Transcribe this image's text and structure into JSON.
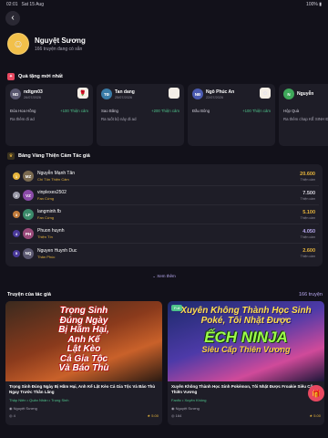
{
  "status": {
    "time": "02:01",
    "date": "Sat 15 Aug",
    "battery": "100%"
  },
  "profile": {
    "name": "Nguyệt Sương",
    "subtitle": "166 truyện đang có sẵn"
  },
  "gifts_section": {
    "title": "Quà tặng mới nhất"
  },
  "gifts": [
    {
      "initials": "ND",
      "name": "ndtgm03",
      "date": "26/07/2026",
      "item": "Đóa Hoa Hồng",
      "points": "+100 Thiện cảm",
      "message": "Ra thêm đi ad",
      "avatar_color": "#5a5870"
    },
    {
      "initials": "TĐ",
      "name": "Tan dang",
      "date": "25/07/2026",
      "item": "Sao Băng",
      "points": "+200 Thiện cảm",
      "message": "Ra tuốt bộ này đi ad",
      "avatar_color": "#3a7ca8"
    },
    {
      "initials": "NĐ",
      "name": "Ngô Phúc An",
      "date": "22/07/2026",
      "item": "Đầu Bông",
      "points": "+100 Thiện cảm",
      "message": "",
      "avatar_color": "#4a5ab0"
    },
    {
      "initials": "N",
      "name": "Nguyễn",
      "date": "",
      "item": "Hộp Quà",
      "points": "",
      "message": "Ra thêm chap KỂ SINH ĐÚNG GIAN",
      "avatar_color": "#3ea85a"
    }
  ],
  "leaderboard_section": {
    "title": "Bảng Vàng Thiện Cảm Tác giả"
  },
  "leaderboard": [
    {
      "rank": "1",
      "initials": "MZ",
      "name": "Nguyễn Mạnh Tân",
      "title": "Chí Tôn Thiện Cảm",
      "score": "20.600",
      "unit": "Thiện cảm",
      "rank_color": "#e6b43c",
      "avatar_color": "#7a6a50",
      "score_color": "#e6b43c"
    },
    {
      "rank": "2",
      "initials": "VZ",
      "name": "vinplexes2502",
      "title": "Fan Cứng",
      "score": "7.500",
      "unit": "Thiện cảm",
      "rank_color": "#9a9aa8",
      "avatar_color": "#8a4aa8",
      "score_color": "#d8d6e0"
    },
    {
      "rank": "3",
      "initials": "LF",
      "name": "langminh.fb",
      "title": "Fan Cứng",
      "score": "5.100",
      "unit": "Thiện cảm",
      "rank_color": "#c07a3a",
      "avatar_color": "#3a8a6a",
      "score_color": "#e6b43c"
    },
    {
      "rank": "4",
      "initials": "PH",
      "name": "Phuon huynh",
      "title": "Thiện Tín",
      "score": "4.050",
      "unit": "Thiện cảm",
      "rank_color": "#4a3a9a",
      "avatar_color": "#9a4a7a",
      "score_color": "#b8a9f0"
    },
    {
      "rank": "5",
      "initials": "NQ",
      "name": "Nguyen Huynh Duc",
      "title": "Thân Phúc",
      "score": "2.600",
      "unit": "Thiện cảm",
      "rank_color": "#4a3a9a",
      "avatar_color": "#5a5870",
      "score_color": "#e6b43c"
    }
  ],
  "more_label": "⌄ Xem thêm",
  "stories_section": {
    "title": "Truyện của tác giả",
    "count": "166 truyện"
  },
  "stories": [
    {
      "cover_text": "Trọng Sinh Đúng Ngày Bị Hãm Hại, Anh Kế Lật Kèo Cả Gia Tộc Và Báo Thù Ngay Trước Thần Lăng",
      "title": "Trọng Sinh Đúng Ngày Bị Hãm Hại, Anh Kế Lật Kèo Cả Gia Tộc Và Báo Thù Ngay Trước Thần Lăng",
      "genre": "Thập Niên • Quân Nhân • Trọng Sinh",
      "author": "Nguyệt Sương",
      "views": "4",
      "rating": "★ 5.00",
      "badge": ""
    },
    {
      "cover_text_top": "Xuyên Không Thành Học Sinh Poké, Tôi Nhặt Được",
      "cover_text_big": "ẾCH NINJA",
      "cover_text_sub": "Siêu Cấp Thiên Vương",
      "title": "Xuyên Không Thành Học Sinh Pokémon, Tôi Nhặt Được Froakie Siêu Cấp Thiên Vương",
      "genre": "Fanfic • Xuyên Không",
      "author": "Nguyệt Sương",
      "views": "164",
      "rating": "★ 5.00",
      "badge": "Full"
    }
  ]
}
